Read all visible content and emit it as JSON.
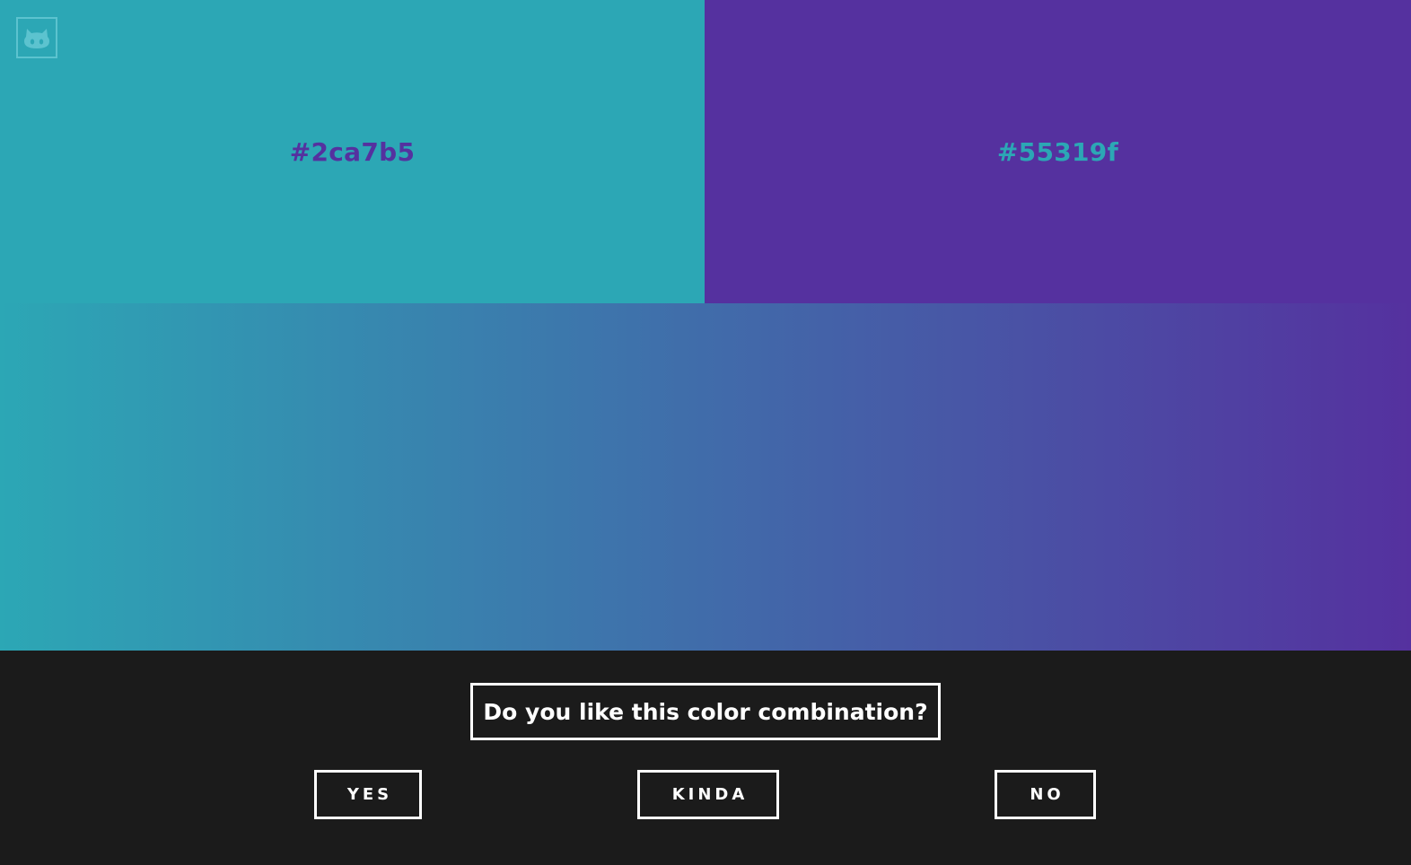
{
  "colors": {
    "left": "#2ca7b5",
    "right": "#55319f",
    "panel_background": "#1b1b1b",
    "button_border": "#ffffff"
  },
  "swatches": {
    "left_hex": "#2ca7b5",
    "right_hex": "#55319f"
  },
  "header": {
    "logo_icon": "github-octocat-icon"
  },
  "survey": {
    "question": "Do you like this color combination?",
    "buttons": {
      "yes": "YES",
      "kinda": "KINDA",
      "no": "NO"
    }
  }
}
